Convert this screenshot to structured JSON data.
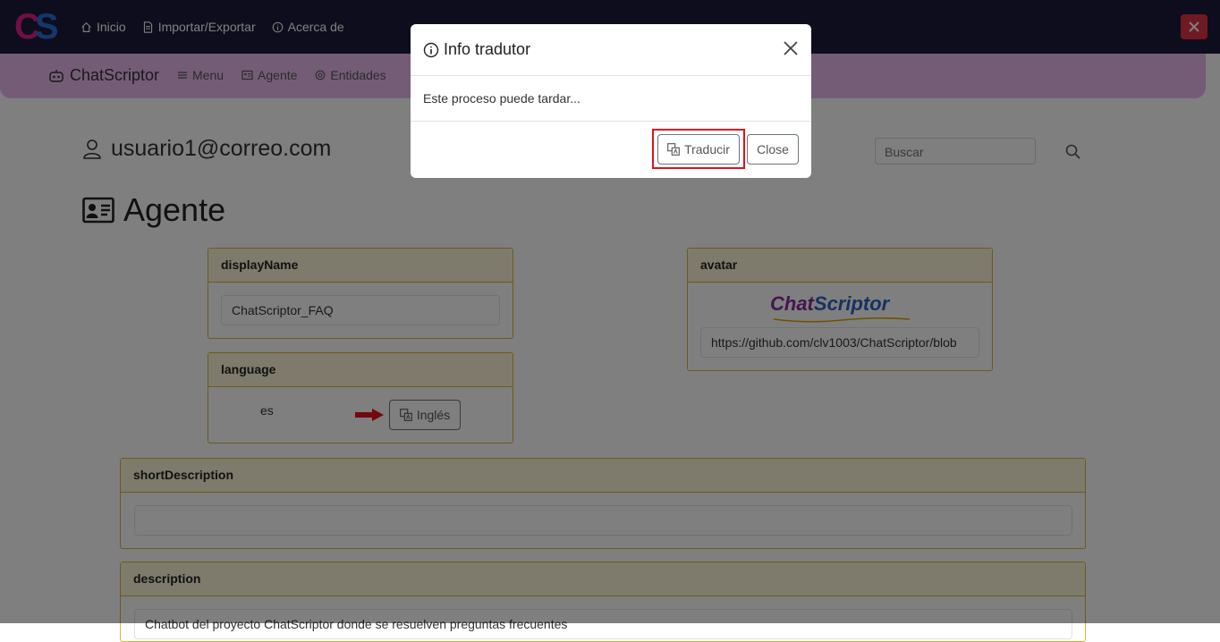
{
  "topbar": {
    "logo_c": "C",
    "logo_s": "S",
    "items": [
      {
        "label": "Inicio",
        "icon": "home-icon"
      },
      {
        "label": "Importar/Exportar",
        "icon": "file-icon"
      },
      {
        "label": "Acerca de",
        "icon": "info-icon"
      }
    ],
    "close_icon": "close-icon",
    "close_color": "#dc3545"
  },
  "subbar": {
    "brand": "ChatScriptor",
    "items": [
      {
        "label": "Menu",
        "icon": "menu-icon"
      },
      {
        "label": "Agente",
        "icon": "id-card-icon"
      },
      {
        "label": "Entidades",
        "icon": "at-icon"
      }
    ]
  },
  "user": {
    "email": "usuario1@correo.com"
  },
  "search": {
    "placeholder": "Buscar"
  },
  "page": {
    "title": "Agente"
  },
  "cards": {
    "displayName": {
      "header": "displayName",
      "value": "ChatScriptor_FAQ"
    },
    "language": {
      "header": "language",
      "code": "es",
      "button": "Inglés"
    },
    "avatar": {
      "header": "avatar",
      "logo_text_a": "Chat",
      "logo_text_b": "Scriptor",
      "url": "https://github.com/clv1003/ChatScriptor/blob"
    },
    "shortDescription": {
      "header": "shortDescription",
      "value": ""
    },
    "description": {
      "header": "description",
      "value": "Chatbot del proyecto ChatScriptor donde se resuelven preguntas frecuentes"
    }
  },
  "modal": {
    "title": "Info tradutor",
    "body": "Este proceso puede tardar...",
    "translate_button": "Traducir",
    "close_button": "Close"
  },
  "colors": {
    "topbar": "#1d1b3a",
    "subbar": "#e9b8ef",
    "card_border": "#d8b43d",
    "highlight": "#e0101e"
  }
}
